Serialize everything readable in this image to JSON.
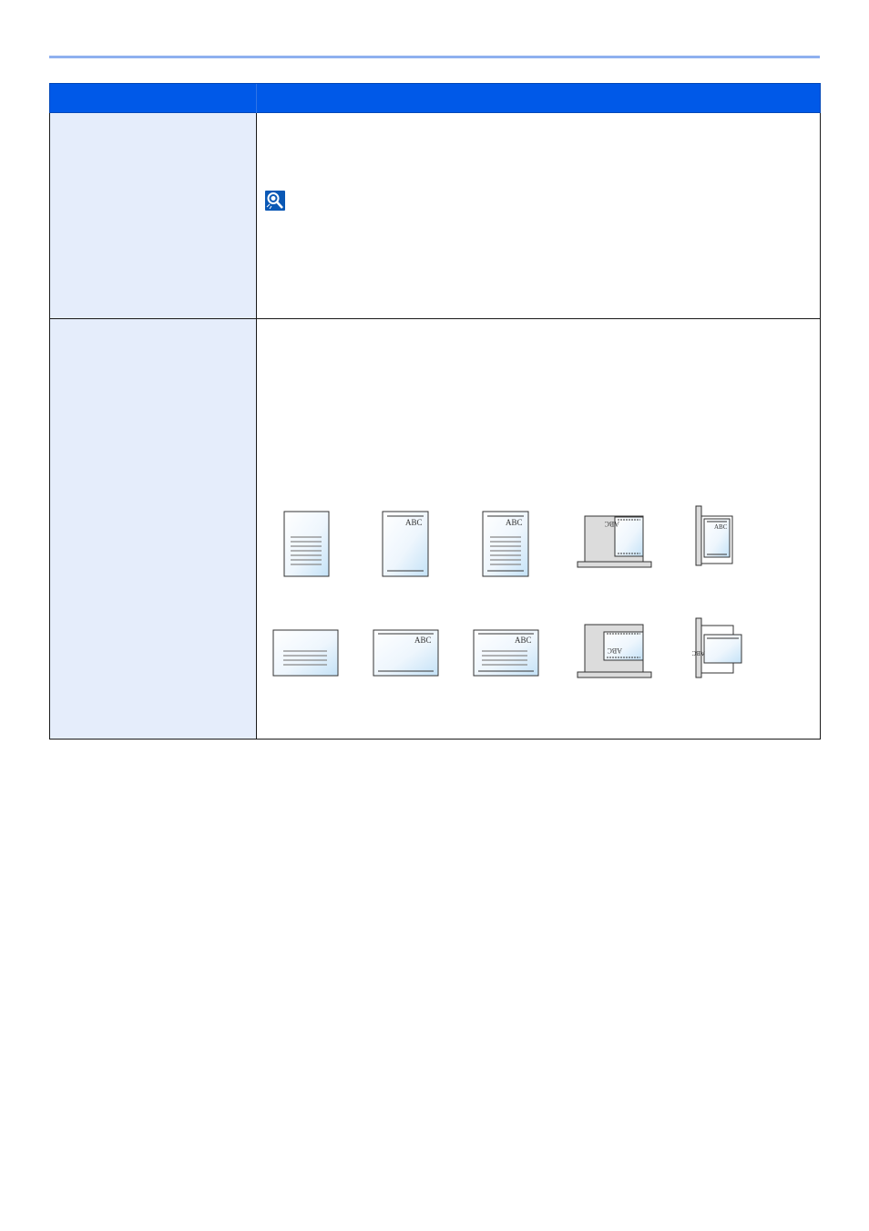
{
  "header": {
    "col1_label": "",
    "col2_label": ""
  },
  "rows": [
    {
      "label": "",
      "note_icon": "note-magnifier-icon"
    },
    {
      "label": "",
      "illustrations": {
        "portrait": [
          "portrait-text-lines-icon",
          "portrait-header-footer-icon",
          "portrait-header-text-footer-icon",
          "portrait-platen-placement-icon",
          "portrait-document-processor-icon"
        ],
        "landscape": [
          "landscape-text-lines-icon",
          "landscape-header-footer-icon",
          "landscape-header-text-footer-icon",
          "landscape-platen-placement-icon",
          "landscape-document-processor-icon"
        ]
      }
    }
  ],
  "sample_text": "ABC",
  "colors": {
    "header_blue": "#0059e8",
    "rule_blue": "#8fb0ef",
    "label_bg": "#e5edfb",
    "icon_blue": "#0a58b5"
  }
}
